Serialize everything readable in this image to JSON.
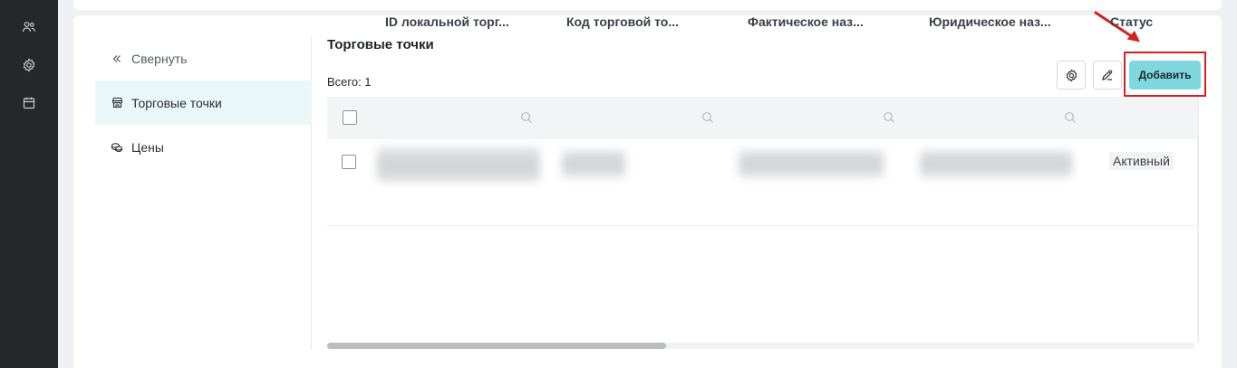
{
  "submenu": {
    "collapse_label": "Свернуть",
    "items": [
      {
        "label": "Торговые точки",
        "icon": "store-icon",
        "active": true
      },
      {
        "label": "Цены",
        "icon": "coins-icon",
        "active": false
      }
    ]
  },
  "page": {
    "title": "Торговые точки",
    "total_label": "Всего: 1"
  },
  "toolbar": {
    "settings_icon": "gear-icon",
    "edit_icon": "pencil-icon",
    "add_label": "Добавить"
  },
  "table": {
    "columns": [
      {
        "label": "ID локальной торг..."
      },
      {
        "label": "Код торговой то..."
      },
      {
        "label": "Фактическое наз..."
      },
      {
        "label": "Юридическое наз..."
      },
      {
        "label": "Статус"
      }
    ],
    "rows": [
      {
        "status": "Активный"
      }
    ]
  },
  "colors": {
    "accent": "#7fd8de",
    "sidebar": "#26272b",
    "highlight": "#d42020"
  }
}
